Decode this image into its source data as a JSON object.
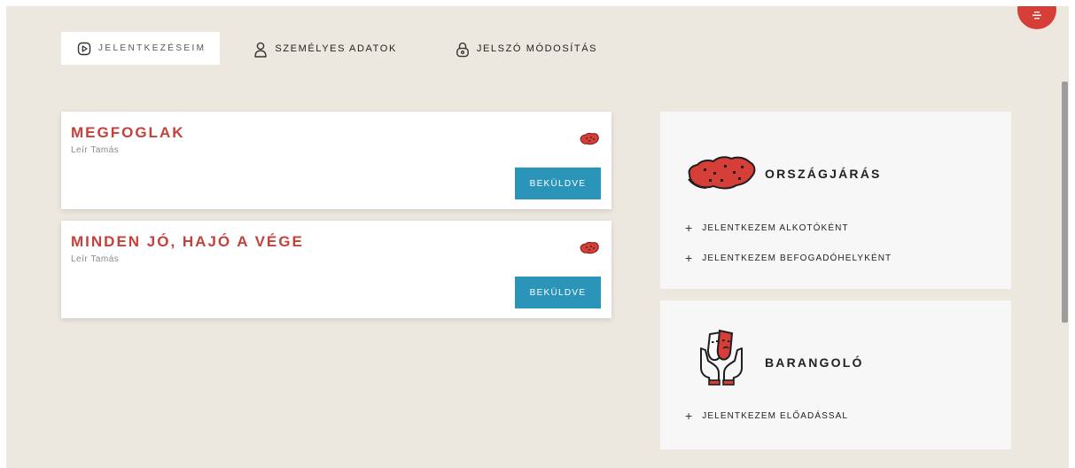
{
  "tabs": [
    {
      "label": "JELENTKEZÉSEIM",
      "icon": "play-circle-icon",
      "active": true
    },
    {
      "label": "SZEMÉLYES ADATOK",
      "icon": "user-icon",
      "active": false
    },
    {
      "label": "JELSZÓ MÓDOSÍTÁS",
      "icon": "lock-icon",
      "active": false
    }
  ],
  "applications": [
    {
      "title": "MEGFOGLAK",
      "author": "Leír Tamás",
      "status": "BEKÜLDVE",
      "icon": "hungary-map-icon"
    },
    {
      "title": "MINDEN JÓ, HAJÓ A VÉGE",
      "author": "Leír Tamás",
      "status": "BEKÜLDVE",
      "icon": "hungary-map-icon"
    }
  ],
  "programs": [
    {
      "title": "ORSZÁGJÁRÁS",
      "icon": "hungary-map-icon",
      "links": [
        "JELENTKEZEM ALKOTÓKÉNT",
        "JELENTKEZEM BEFOGADÓHELYKÉNT"
      ]
    },
    {
      "title": "BARANGOLÓ",
      "icon": "theater-masks-hands-icon",
      "links": [
        "JELENTKEZEM ELŐADÁSSAL"
      ]
    }
  ],
  "colors": {
    "accent": "#c4413c",
    "status_button": "#2a95b8",
    "background": "#ece8e0",
    "menu_button": "#d63f37"
  }
}
